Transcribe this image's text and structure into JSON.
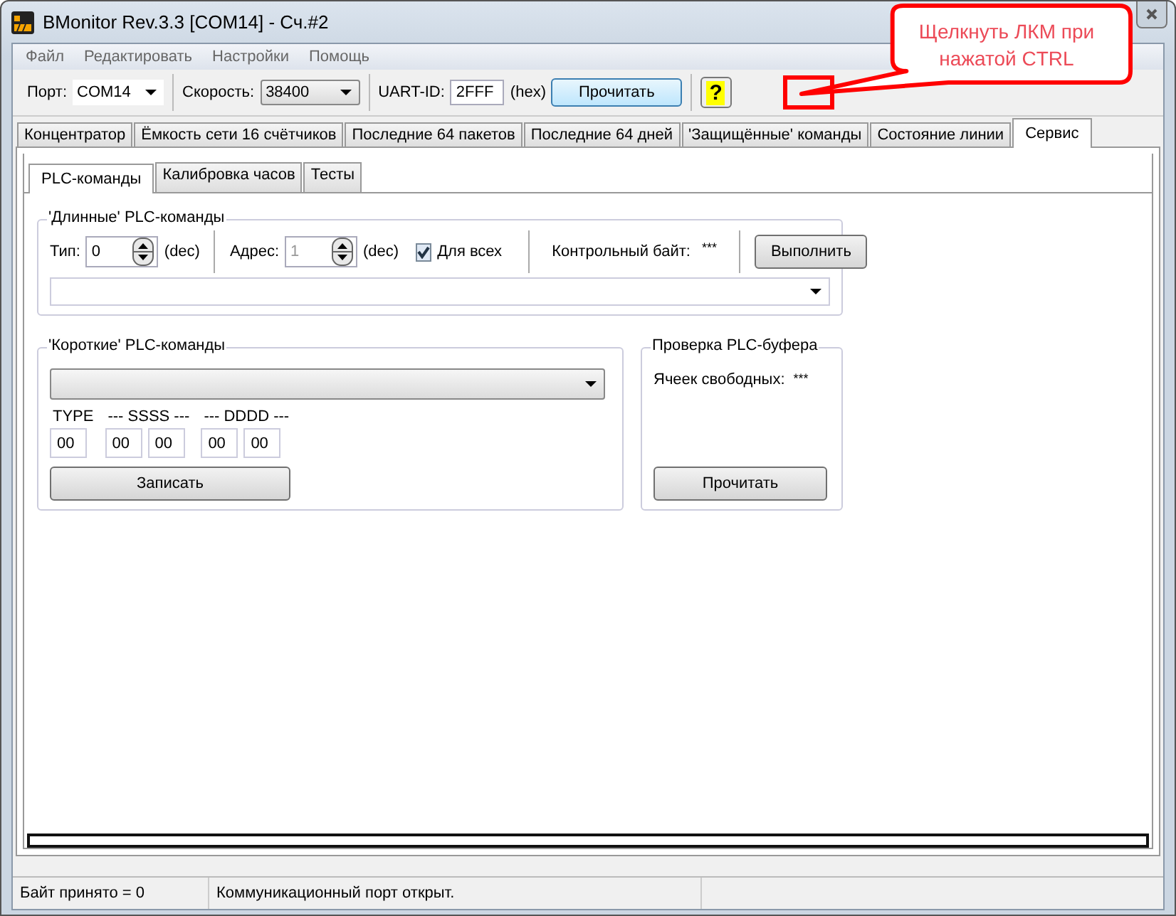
{
  "window": {
    "title": "BMonitor Rev.3.3 [COM14] - Сч.#2"
  },
  "menu": [
    "Файл",
    "Редактировать",
    "Настройки",
    "Помощь"
  ],
  "toolbar": {
    "port": {
      "label": "Порт:",
      "value": "COM14"
    },
    "speed": {
      "label": "Скорость:",
      "value": "38400"
    },
    "uart": {
      "label": "UART-ID:",
      "value": "2FFF",
      "unit": "(hex)"
    },
    "read_button": "Прочитать",
    "help_button": "?"
  },
  "main_tabs": [
    {
      "label": "Концентратор",
      "selected": false
    },
    {
      "label": "Ёмкость сети 16 счётчиков",
      "selected": false
    },
    {
      "label": "Последние 64 пакетов",
      "selected": false
    },
    {
      "label": "Последние 64 дней",
      "selected": false
    },
    {
      "label": "'Защищённые' команды",
      "selected": false
    },
    {
      "label": "Состояние линии",
      "selected": false
    },
    {
      "label": "Сервис",
      "selected": true
    }
  ],
  "sub_tabs": [
    {
      "label": "PLC-команды",
      "selected": true
    },
    {
      "label": "Калибровка часов",
      "selected": false
    },
    {
      "label": "Тесты",
      "selected": false
    }
  ],
  "long_commands": {
    "title": "'Длинные' PLC-команды",
    "type": {
      "label": "Тип:",
      "value": "0",
      "unit": "(dec)",
      "disabled": false
    },
    "address": {
      "label": "Адрес:",
      "value": "1",
      "unit": "(dec)",
      "disabled": true
    },
    "for_all": {
      "label": "Для всех",
      "checked": true
    },
    "checksum_label": "Контрольный байт:",
    "checksum_value": "***",
    "execute_button": "Выполнить"
  },
  "short_commands": {
    "title": "'Короткие' PLC-команды",
    "groups": [
      {
        "label": "TYPE",
        "values": [
          "00"
        ]
      },
      {
        "label": "--- SSSS ---",
        "values": [
          "00",
          "00"
        ]
      },
      {
        "label": "--- DDDD ---",
        "values": [
          "00",
          "00"
        ]
      }
    ],
    "write_button": "Записать"
  },
  "buffer_check": {
    "title": "Проверка PLC-буфера",
    "free_label": "Ячеек свободных:",
    "free_value": "***",
    "read_button": "Прочитать"
  },
  "status_bar": [
    "Байт принято = 0",
    "Коммуникационный порт открыт."
  ],
  "annotation": {
    "text": "Щелкнуть ЛКМ при нажатой CTRL"
  }
}
